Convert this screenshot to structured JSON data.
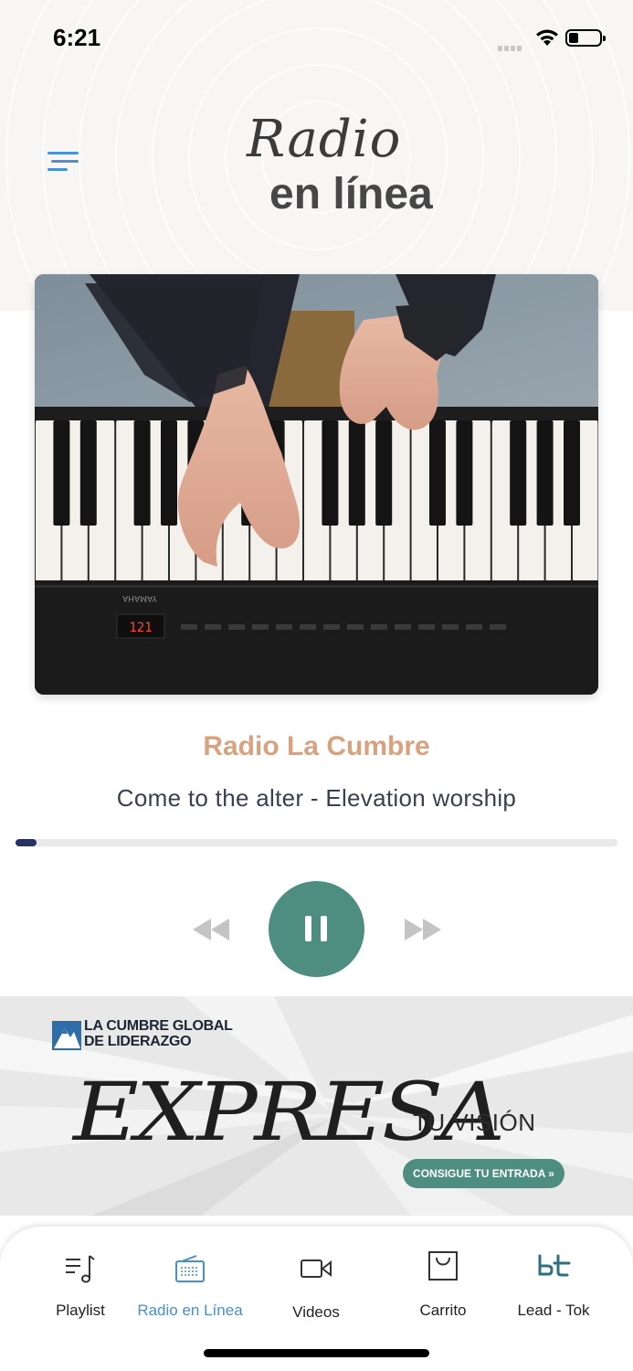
{
  "status_bar": {
    "time": "6:21"
  },
  "header": {
    "title_line1": "Radio",
    "title_line2": "en línea"
  },
  "player": {
    "station": "Radio La Cumbre",
    "song": "Come to the alter - Elevation worship",
    "progress": 0.035,
    "display_readout": "121",
    "piano_brand": "YAMAHA"
  },
  "banner": {
    "brand_line1": "LA CUMBRE GLOBAL",
    "brand_line2": "DE LIDERAZGO",
    "headline": "EXPRESA",
    "subline": "TU VISIÓN",
    "cta": "CONSIGUE TU ENTRADA »"
  },
  "tabbar": {
    "items": [
      {
        "label": "Playlist",
        "icon": "music-note-icon"
      },
      {
        "label": "Radio en Línea",
        "icon": "radio-icon",
        "active": true
      },
      {
        "label": "Videos",
        "icon": "video-camera-icon"
      },
      {
        "label": "Carrito",
        "icon": "cart-icon"
      },
      {
        "label": "Lead - Tok",
        "icon": "lead-tok-logo-icon"
      }
    ]
  },
  "colors": {
    "accent_teal": "#4d8e80",
    "station_title": "#d9a27f",
    "progress_fill": "#253363",
    "active_tab": "#4a8fc8",
    "menu_icon": "#4a90d9"
  }
}
